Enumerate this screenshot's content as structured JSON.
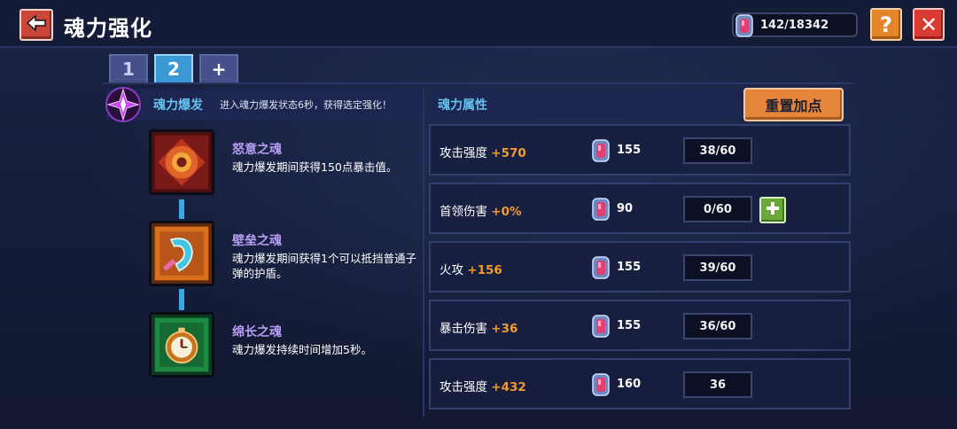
{
  "header": {
    "title": "魂力强化",
    "currency": "142/18342",
    "help_label": "?",
    "close_label": "✕"
  },
  "tabs": [
    {
      "label": "1",
      "active": false
    },
    {
      "label": "2",
      "active": true
    },
    {
      "label": "+",
      "active": false
    }
  ],
  "burst": {
    "title": "魂力爆发",
    "description": "进入魂力爆发状态6秒，获得选定强化！"
  },
  "souls": [
    {
      "name": "怒意之魂",
      "description": "魂力爆发期间获得150点暴击值。",
      "icon": "rage-soul-icon"
    },
    {
      "name": "壁垒之魂",
      "description": "魂力爆发期间获得1个可以抵挡普通子弹的护盾。",
      "icon": "bulwark-soul-icon"
    },
    {
      "name": "绵长之魂",
      "description": "魂力爆发持续时间增加5秒。",
      "icon": "longevity-soul-icon"
    }
  ],
  "attributes": {
    "title": "魂力属性",
    "reset_label": "重置加点",
    "rows": [
      {
        "name": "攻击强度",
        "bonus": "+570",
        "cost": "155",
        "level": "38/60",
        "can_add": false
      },
      {
        "name": "首领伤害",
        "bonus": "+0%",
        "cost": "90",
        "level": "0/60",
        "can_add": true
      },
      {
        "name": "火攻",
        "bonus": "+156",
        "cost": "155",
        "level": "39/60",
        "can_add": false
      },
      {
        "name": "暴击伤害",
        "bonus": "+36",
        "cost": "155",
        "level": "36/60",
        "can_add": false
      },
      {
        "name": "攻击强度",
        "bonus": "+432",
        "cost": "160",
        "level": "36",
        "can_add": false
      }
    ]
  },
  "colors": {
    "accent_blue": "#63c2ef",
    "bonus_orange": "#f39a2c",
    "soul_name_purple": "#b69cf2"
  }
}
